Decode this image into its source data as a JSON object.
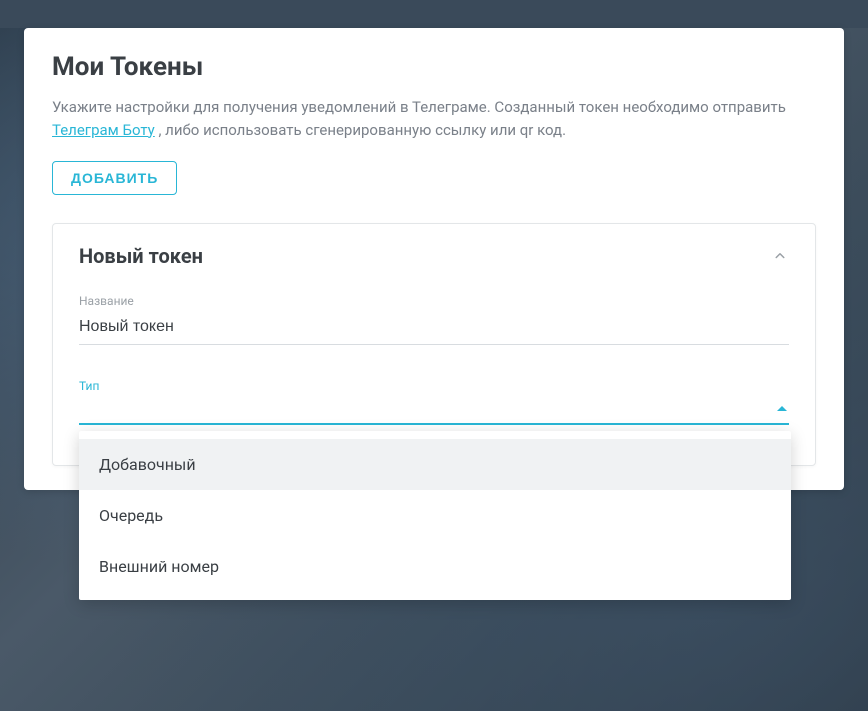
{
  "page": {
    "title": "Мои Токены",
    "description_pre": "Укажите настройки для получения уведомлений в Телеграме. Созданный токен необходимо отправить ",
    "description_link": "Телеграм Боту",
    "description_post": " , либо использовать сгенерированную ссылку или qr код.",
    "add_button": "ДОБАВИТЬ"
  },
  "token_card": {
    "title": "Новый токен",
    "name_label": "Название",
    "name_value": "Новый токен",
    "type_label": "Тип",
    "type_value": "",
    "type_options": [
      "Добавочный",
      "Очередь",
      "Внешний номер"
    ]
  }
}
